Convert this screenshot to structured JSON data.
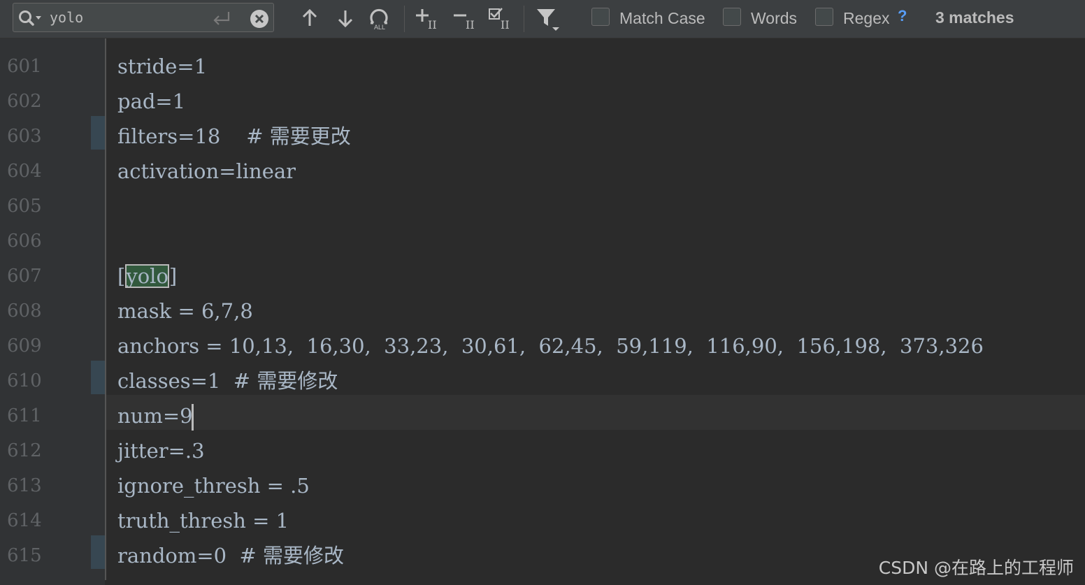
{
  "find_bar": {
    "query": "yolo",
    "options": {
      "match_case": "Match Case",
      "words": "Words",
      "regex": "Regex",
      "help": "?"
    },
    "match_count": "3 matches",
    "icons": [
      "search-history-icon",
      "enter-icon",
      "clear-icon",
      "previous-occurrence-icon",
      "next-occurrence-icon",
      "select-all-occurrences-icon",
      "add-occurrence-icon",
      "remove-occurrence-icon",
      "select-occurrence-icon",
      "filter-icon"
    ]
  },
  "editor": {
    "lines": [
      {
        "number": "601",
        "text": "stride=1"
      },
      {
        "number": "602",
        "text": "pad=1"
      },
      {
        "number": "603",
        "text": "filters=18    # 需要更改"
      },
      {
        "number": "604",
        "text": "activation=linear"
      },
      {
        "number": "605",
        "text": ""
      },
      {
        "number": "606",
        "text": ""
      },
      {
        "number": "607",
        "text_before": "[",
        "text_match": "yolo",
        "text_after": "]"
      },
      {
        "number": "608",
        "text": "mask = 6,7,8"
      },
      {
        "number": "609",
        "text": "anchors = 10,13,  16,30,  33,23,  30,61,  62,45,  59,119,  116,90,  156,198,  373,326"
      },
      {
        "number": "610",
        "text": "classes=1  # 需要修改"
      },
      {
        "number": "611",
        "text": "num=9"
      },
      {
        "number": "612",
        "text": "jitter=.3"
      },
      {
        "number": "613",
        "text": "ignore_thresh = .5"
      },
      {
        "number": "614",
        "text": "truth_thresh = 1"
      },
      {
        "number": "615",
        "text": "random=0  # 需要修改"
      }
    ]
  },
  "watermark": "CSDN @在路上的工程师",
  "colors": {
    "background": "#2b2b2b",
    "toolbar": "#3c3f41",
    "gutter": "#313335",
    "line_number": "#606366",
    "code_text": "#a9b7c6",
    "match_highlight": "#32593d",
    "change_marker": "#374752",
    "help_link": "#589df6"
  }
}
